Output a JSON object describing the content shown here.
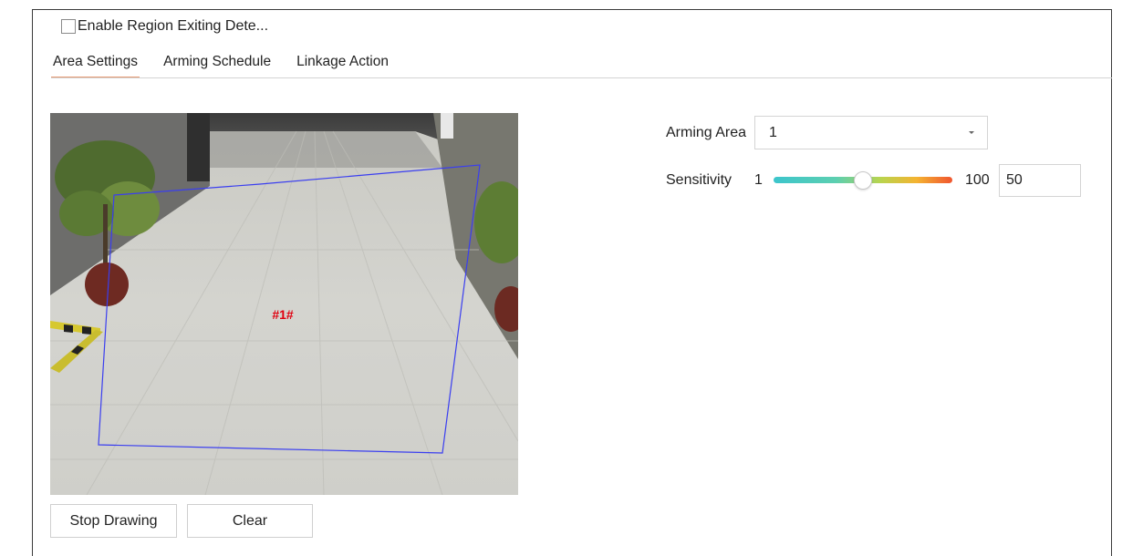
{
  "enable": {
    "label": "Enable Region Exiting Dete...",
    "checked": false
  },
  "tabs": [
    {
      "label": "Area Settings",
      "active": true
    },
    {
      "label": "Arming Schedule",
      "active": false
    },
    {
      "label": "Linkage Action",
      "active": false
    }
  ],
  "preview": {
    "region_label": "#1#",
    "region_color": "#3a3ef0",
    "label_color": "#e0000f"
  },
  "buttons": {
    "stop_drawing": "Stop Drawing",
    "clear": "Clear"
  },
  "arming_area": {
    "label": "Arming Area",
    "value": "1"
  },
  "sensitivity": {
    "label": "Sensitivity",
    "min": "1",
    "max": "100",
    "value": "50",
    "level_percent": 50
  }
}
